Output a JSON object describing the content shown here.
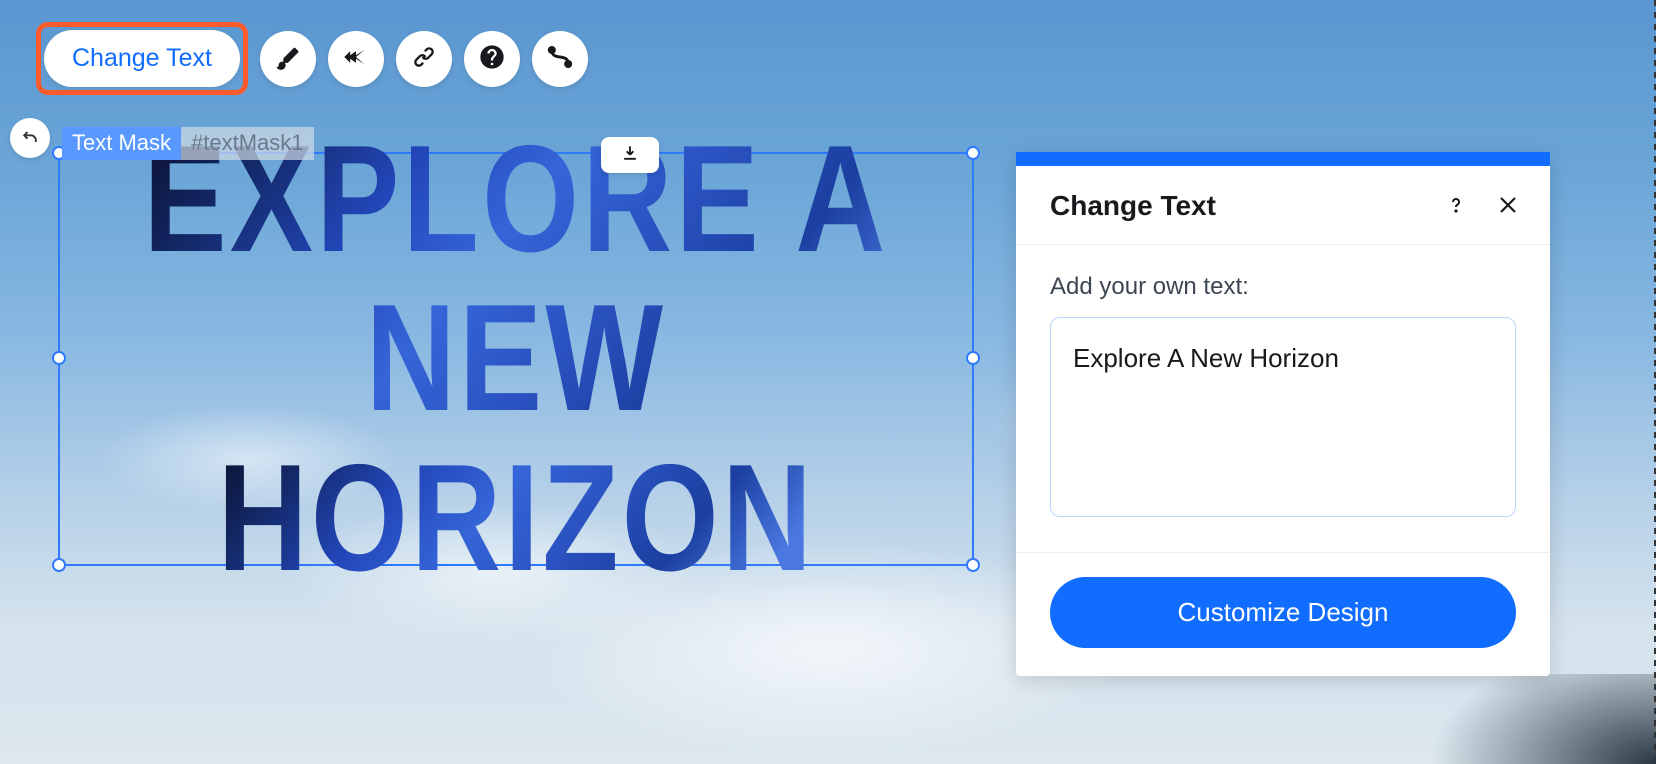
{
  "toolbar": {
    "change_text_label": "Change Text"
  },
  "selection": {
    "element_type": "Text Mask",
    "element_id": "#textMask1",
    "content_line1": "EXPLORE A NEW",
    "content_line2": "HORIZON"
  },
  "panel": {
    "title": "Change Text",
    "field_label": "Add your own text:",
    "text_value": "Explore A New Horizon",
    "customize_label": "Customize Design"
  },
  "colors": {
    "accent": "#116dff",
    "highlight": "#ff5a2c"
  }
}
